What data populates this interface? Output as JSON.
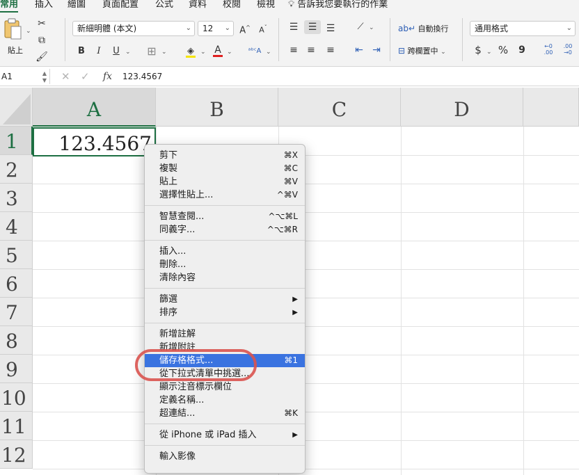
{
  "ribbon_tabs": [
    "常用",
    "插入",
    "繪圖",
    "頁面配置",
    "公式",
    "資料",
    "校閱",
    "檢視"
  ],
  "tell_me": "告訴我您要執行的作業",
  "ribbon": {
    "paste_label": "貼上",
    "font_name": "新細明體 (本文)",
    "font_size": "12",
    "wrap_text": "自動換行",
    "merge_center": "跨欄置中",
    "number_format": "通用格式",
    "bold": "B",
    "italic": "I",
    "underline": "U",
    "currency": "$",
    "percent": "%",
    "comma": "9",
    "inc_font": "A",
    "dec_font": "A",
    "font_color_letter": "A",
    "dec_more": "←0\n.00",
    "dec_less": ".00\n→0"
  },
  "formula_bar": {
    "name_box": "A1",
    "fx": "fx",
    "value": "123.4567"
  },
  "grid": {
    "columns": [
      "A",
      "B",
      "C",
      "D"
    ],
    "rows": [
      "1",
      "2",
      "3",
      "4",
      "5",
      "6",
      "7",
      "8",
      "9",
      "10",
      "11",
      "12"
    ],
    "a1_value": "123.4567"
  },
  "context_menu": {
    "groups": [
      [
        {
          "label": "剪下",
          "shortcut": "⌘X"
        },
        {
          "label": "複製",
          "shortcut": "⌘C"
        },
        {
          "label": "貼上",
          "shortcut": "⌘V"
        },
        {
          "label": "選擇性貼上...",
          "shortcut": "^⌘V"
        }
      ],
      [
        {
          "label": "智慧查閱...",
          "shortcut": "^⌥⌘L"
        },
        {
          "label": "同義字...",
          "shortcut": "^⌥⌘R"
        }
      ],
      [
        {
          "label": "插入..."
        },
        {
          "label": "刪除..."
        },
        {
          "label": "清除內容"
        }
      ],
      [
        {
          "label": "篩選",
          "arrow": "▶"
        },
        {
          "label": "排序",
          "arrow": "▶"
        }
      ],
      [
        {
          "label": "新增註解"
        },
        {
          "label": "新增附註"
        },
        {
          "label": "儲存格格式...",
          "shortcut": "⌘1",
          "highlighted": true
        },
        {
          "label": "從下拉式清單中挑選..."
        },
        {
          "label": "顯示注音標示欄位"
        },
        {
          "label": "定義名稱..."
        },
        {
          "label": "超連結...",
          "shortcut": "⌘K"
        }
      ],
      [
        {
          "label": "從 iPhone 或 iPad 插入",
          "arrow": "▶"
        }
      ],
      [
        {
          "label": "輸入影像"
        }
      ]
    ]
  },
  "colors": {
    "accent_green": "#1d6f42",
    "menu_highlight": "#3a73e0",
    "annotation_red": "#d9534f"
  }
}
